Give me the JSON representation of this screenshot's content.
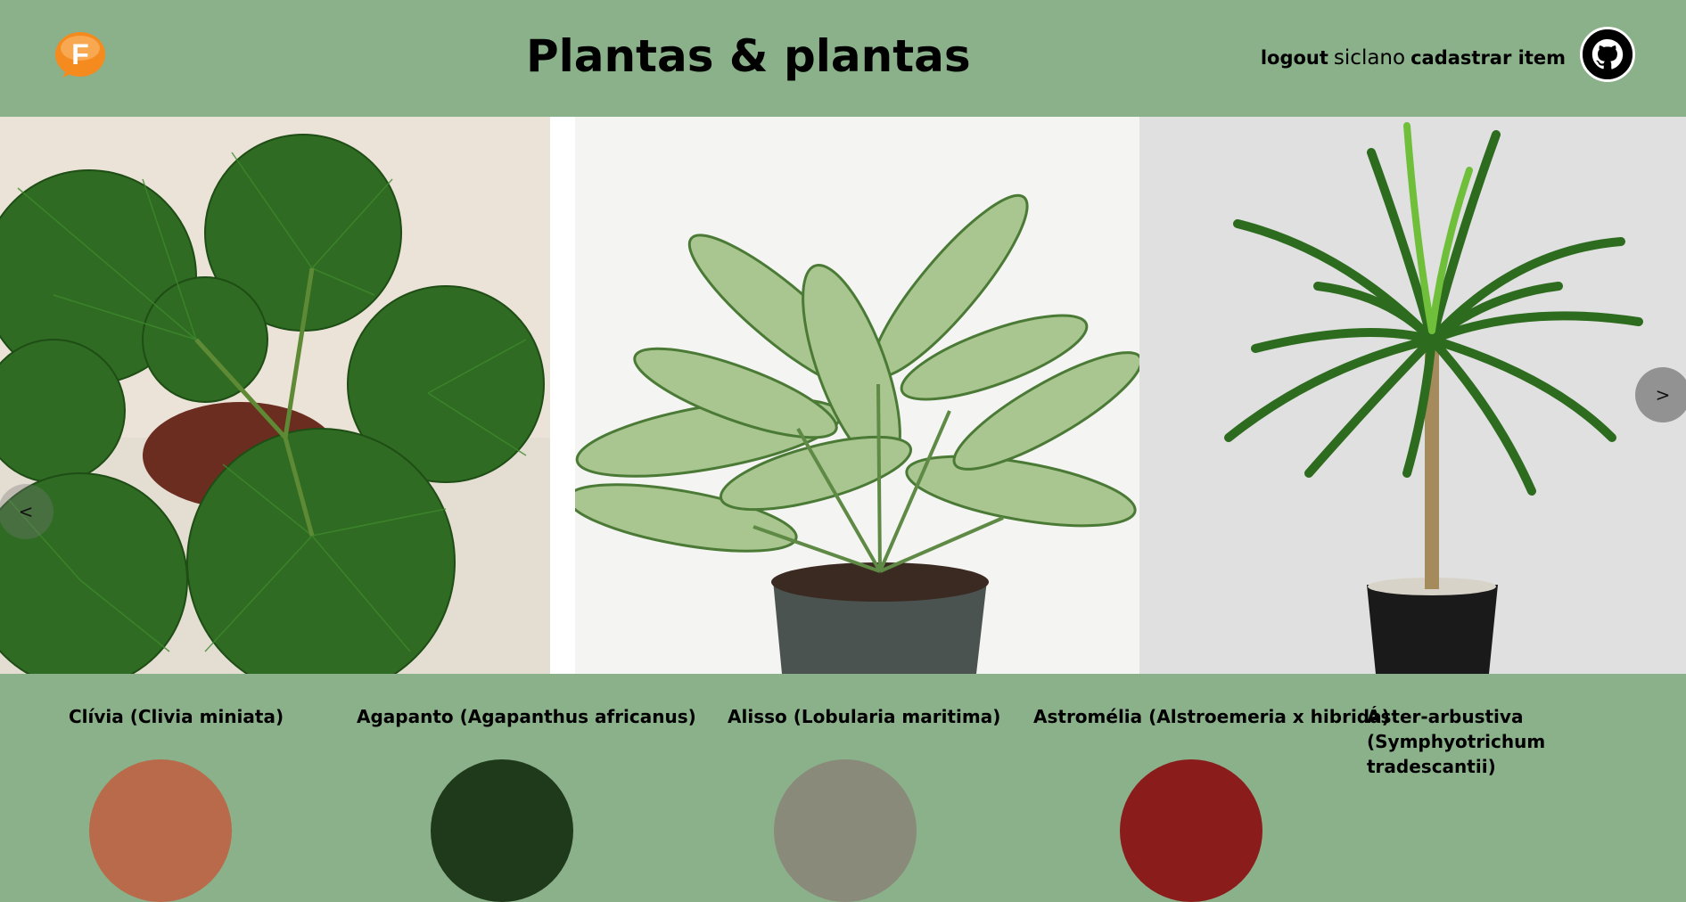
{
  "header": {
    "title": "Plantas & plantas",
    "logout_label": "logout",
    "username": "siclano",
    "register_label": "cadastrar item"
  },
  "carousel": {
    "prev_label": "<",
    "next_label": ">"
  },
  "products": [
    {
      "name": "Clívia (Clivia miniata)"
    },
    {
      "name": "Agapanto (Agapanthus africanus)"
    },
    {
      "name": "Alisso (Lobularia maritima)"
    },
    {
      "name": "Astromélia (Alstroemeria x hibrida)"
    },
    {
      "name": "Áster-arbustiva (Symphyotrichum tradescantii)"
    }
  ],
  "colors": {
    "background": "#8bb18b",
    "logo": "#f58a1f",
    "arrow": "#7a7a7a"
  }
}
